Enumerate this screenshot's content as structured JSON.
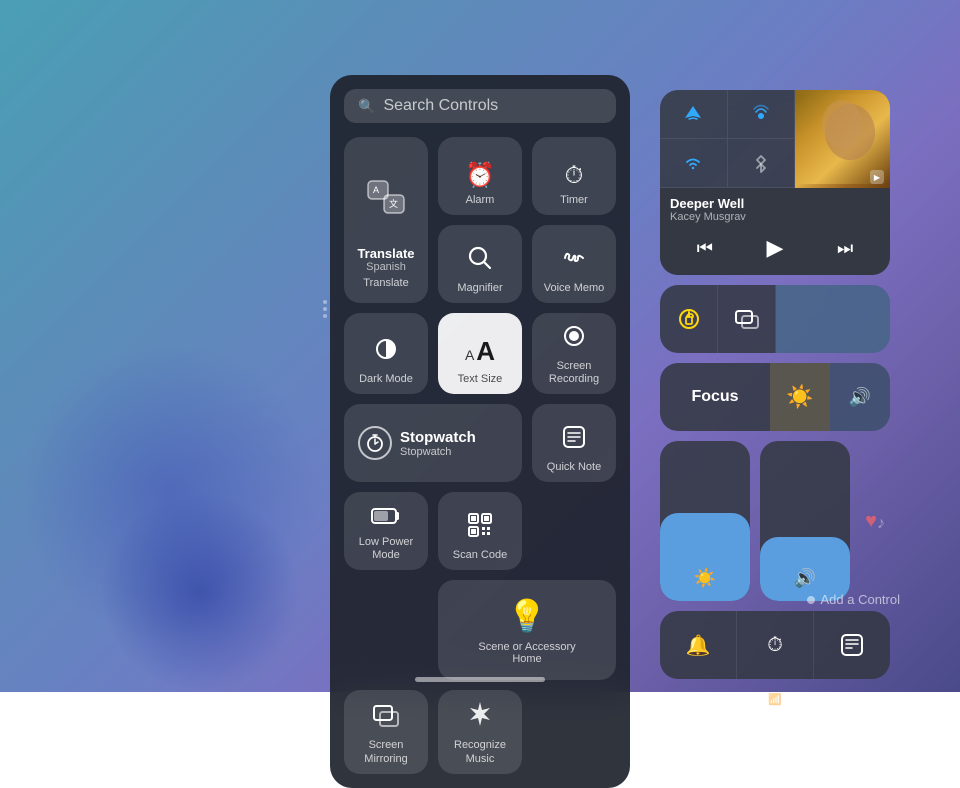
{
  "background": {
    "gradient_desc": "blue-purple iPad background"
  },
  "search_bar": {
    "placeholder": "Search Controls",
    "icon": "🔍"
  },
  "cc_panel": {
    "items": [
      {
        "id": "translate",
        "label": "Translate",
        "sublabel": "Spanish",
        "icon": "🔄",
        "type": "translate"
      },
      {
        "id": "alarm",
        "label": "Alarm",
        "icon": "⏰"
      },
      {
        "id": "timer",
        "label": "Timer",
        "icon": "⏱"
      },
      {
        "id": "magnifier",
        "label": "Magnifier",
        "icon": "🔍"
      },
      {
        "id": "voice-memo",
        "label": "Voice Memo",
        "icon": "🎙"
      },
      {
        "id": "dark-mode",
        "label": "Dark Mode",
        "icon": "◐"
      },
      {
        "id": "text-size",
        "label": "Text Size",
        "icon": "AA",
        "type": "textsize"
      },
      {
        "id": "screen-recording",
        "label": "Screen\nRecording",
        "icon": "⏺"
      },
      {
        "id": "stopwatch",
        "label": "Stopwatch",
        "title": "Stopwatch",
        "type": "stopwatch"
      },
      {
        "id": "quick-note",
        "label": "Quick Note",
        "icon": "⊞"
      },
      {
        "id": "low-power",
        "label": "Low Power\nMode",
        "icon": "🔋"
      },
      {
        "id": "scan-code",
        "label": "Scan Code",
        "icon": "⊞"
      },
      {
        "id": "home",
        "label": "Home",
        "sublabel": "Scene or Accessory",
        "type": "home"
      },
      {
        "id": "screen-mirroring",
        "label": "Screen\nMirroring",
        "icon": "⊡"
      },
      {
        "id": "recognize-music",
        "label": "Recognize\nMusic",
        "icon": "❇"
      }
    ]
  },
  "right_panel": {
    "connectivity": {
      "airplane": {
        "icon": "✈",
        "active": true
      },
      "wifi_call": {
        "icon": "📶",
        "active": true
      },
      "wifi": {
        "icon": "wifi",
        "active": true
      },
      "bluetooth": {
        "icon": "bluetooth",
        "active": true
      }
    },
    "now_playing": {
      "title": "Deeper Well",
      "artist": "Kacey Musgrav",
      "album_art_desc": "album cover"
    },
    "focus": {
      "label": "Focus"
    },
    "brightness_pct": 55,
    "volume_pct": 40,
    "bottom_row": {
      "bell": {
        "icon": "🔔"
      },
      "timer2": {
        "icon": "⏱"
      },
      "notes": {
        "icon": "📋"
      }
    }
  },
  "add_control": {
    "label": "Add a Control"
  }
}
